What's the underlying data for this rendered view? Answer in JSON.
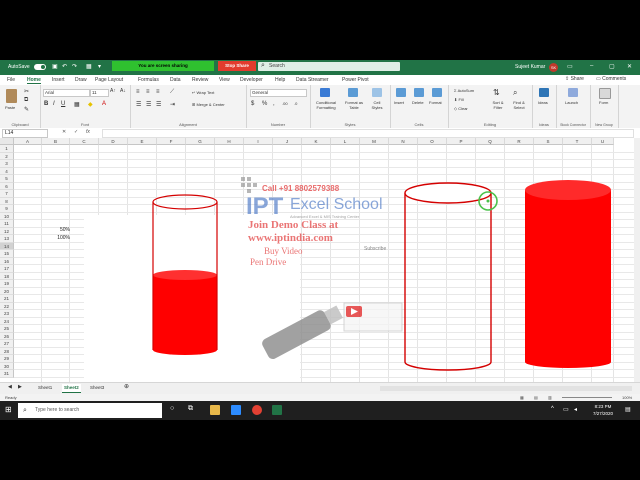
{
  "titlebar": {
    "autosave": "AutoSave",
    "sharing_banner": "You are screen sharing",
    "stop_share": "Stop Share",
    "search_placeholder": "Search",
    "user_name": "Sujeet Kumar",
    "user_initials": "SK"
  },
  "menu": {
    "tabs": [
      "File",
      "Home",
      "Insert",
      "Draw",
      "Page Layout",
      "Formulas",
      "Data",
      "Review",
      "View",
      "Developer",
      "Help",
      "Data Streamer",
      "Power Pivot"
    ],
    "active": "Home",
    "share": "Share",
    "comments": "Comments"
  },
  "ribbon": {
    "paste": "Paste",
    "font_name": "Arial",
    "font_size": "11",
    "wrap_text": "Wrap Text",
    "merge_center": "Merge & Center",
    "number_format": "General",
    "conditional_formatting": "Conditional Formatting",
    "format_as_table": "Format as Table",
    "cell_styles": "Cell Styles",
    "insert": "Insert",
    "delete": "Delete",
    "format": "Format",
    "autosum": "AutoSum",
    "fill": "Fill",
    "clear": "Clear",
    "sort_filter": "Sort & Filter",
    "find_select": "Find & Select",
    "ideas": "Ideas",
    "launch": "Launch",
    "form": "Form",
    "groups": {
      "clipboard": "Clipboard",
      "font": "Font",
      "alignment": "Alignment",
      "number": "Number",
      "styles": "Styles",
      "cells": "Cells",
      "editing": "Editing",
      "ideas": "Ideas",
      "stock_connector": "Stock Connector",
      "new_group": "New Group"
    }
  },
  "formula_bar": {
    "name_box": "L14",
    "fx": "fx",
    "value": ""
  },
  "grid": {
    "columns": [
      "A",
      "B",
      "C",
      "D",
      "E",
      "F",
      "G",
      "H",
      "I",
      "J",
      "K",
      "L",
      "M",
      "N",
      "O",
      "P",
      "Q",
      "R",
      "S",
      "T",
      "U"
    ],
    "rows": [
      "1",
      "2",
      "3",
      "4",
      "5",
      "6",
      "7",
      "8",
      "9",
      "10",
      "11",
      "12",
      "13",
      "14",
      "15",
      "16",
      "17",
      "18",
      "19",
      "20",
      "21",
      "22",
      "23",
      "24",
      "25",
      "26",
      "27",
      "28",
      "29",
      "30",
      "31"
    ],
    "selected_row": "14",
    "cells": {
      "B4": "50%",
      "B5": "100%"
    }
  },
  "watermark": {
    "phone": "Call +91 8802579388",
    "brand_ipt": "IPT",
    "brand_school": "Excel School",
    "tagline": "Advanced Excel & MIS Training Center",
    "demo": "Join Demo Class at",
    "url": "www.iptindia.com",
    "buy_video": "Buy Video",
    "pen_drive": "Pen Drive",
    "subscribe": "Subscribe"
  },
  "fill_levels": {
    "first_cylinder": 0.5,
    "third_cylinder": 1.0
  },
  "colors": {
    "excel_green": "#217346",
    "fill_red": "#ff0000",
    "outline_red": "#d40000"
  },
  "sheets": {
    "tabs": [
      "Sheet1",
      "Sheet2",
      "Sheet3"
    ],
    "active": "Sheet2"
  },
  "status": {
    "ready": "Ready",
    "zoom": "100%"
  },
  "taskbar": {
    "search_placeholder": "Type here to search",
    "time": "8:23 PM",
    "date": "7/27/2020"
  }
}
